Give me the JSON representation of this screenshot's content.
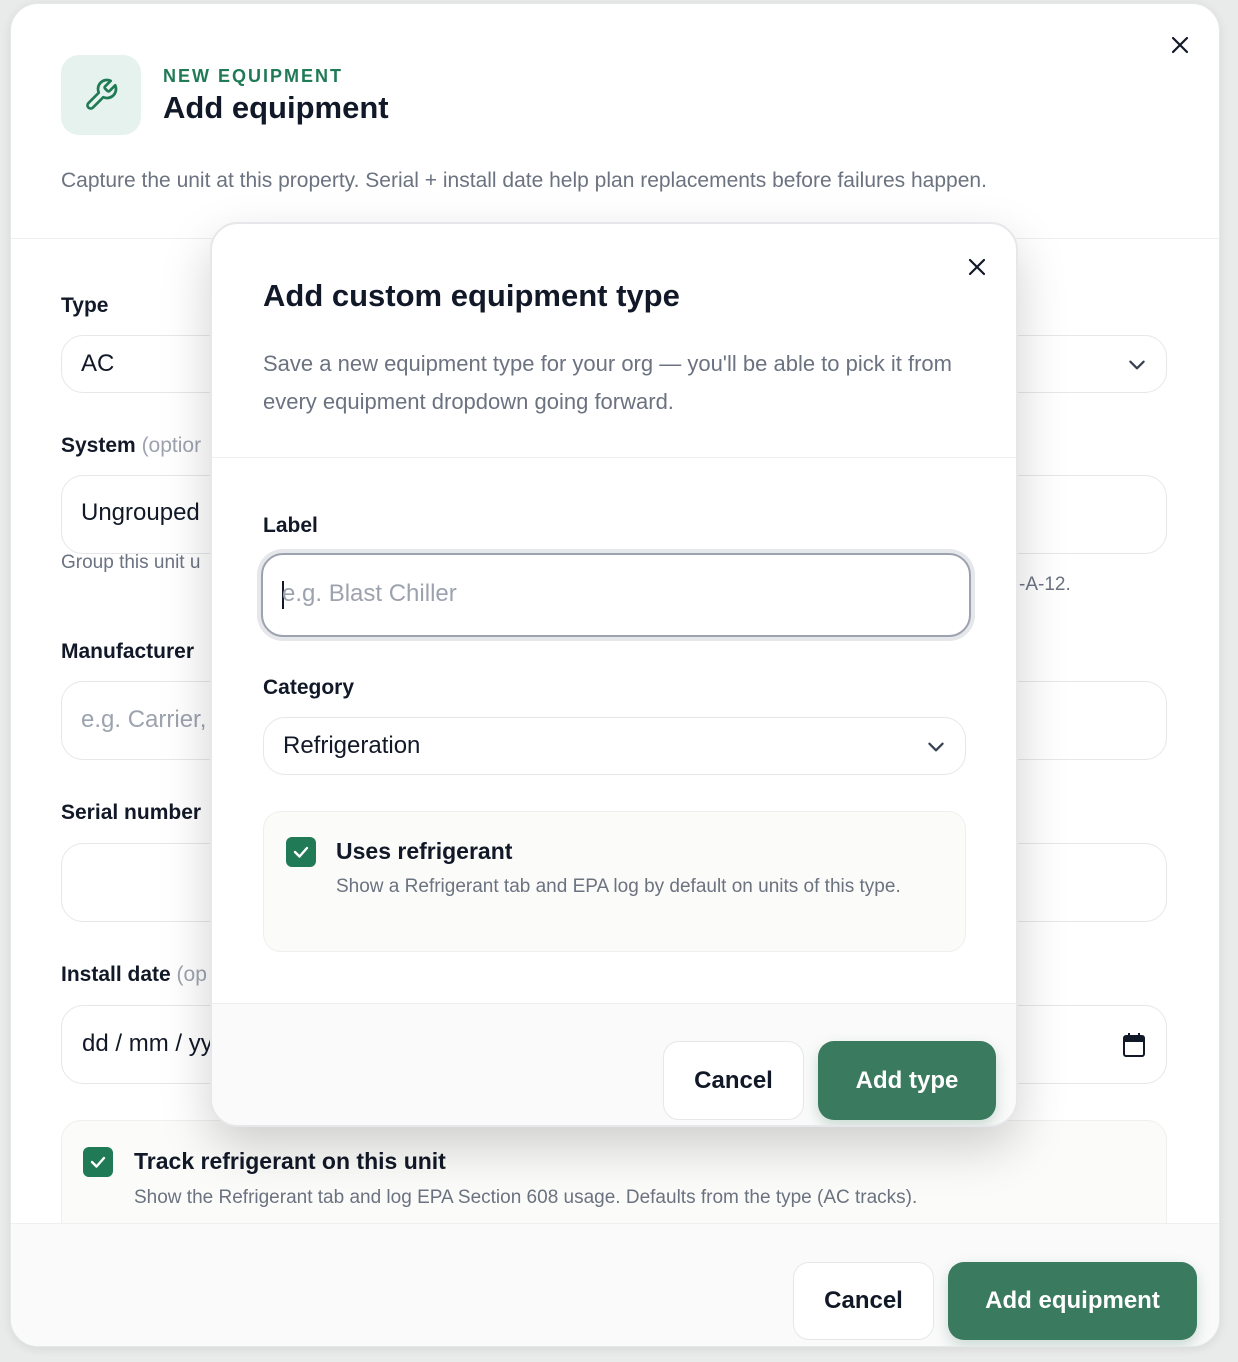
{
  "outer": {
    "eyebrow": "NEW EQUIPMENT",
    "title": "Add equipment",
    "subtitle": "Capture the unit at this property. Serial + install date help plan replacements before failures happen.",
    "icons": {
      "header": "wrench-icon",
      "close": "close-icon"
    },
    "fields": {
      "type": {
        "label": "Type",
        "value": "AC"
      },
      "system": {
        "label": "System",
        "optional": "(optior",
        "value": "Ungrouped",
        "hint": "Group this unit u",
        "hint_right": "-A-12."
      },
      "manufacturer": {
        "label": "Manufacturer",
        "placeholder": "e.g. Carrier,"
      },
      "serial": {
        "label": "Serial number",
        "value": ""
      },
      "install_date": {
        "label": "Install date",
        "optional": "(op",
        "value": "dd / mm / yy"
      }
    },
    "track": {
      "title": "Track refrigerant on this unit",
      "desc": "Show the Refrigerant tab and log EPA Section 608 usage. Defaults from the type (AC tracks).",
      "checked": true
    },
    "footer": {
      "cancel": "Cancel",
      "submit": "Add equipment"
    }
  },
  "inner": {
    "title": "Add custom equipment type",
    "desc": "Save a new equipment type for your org — you'll be able to pick it from every equipment dropdown going forward.",
    "label_field": {
      "label": "Label",
      "placeholder": "e.g. Blast Chiller"
    },
    "category_field": {
      "label": "Category",
      "value": "Refrigeration"
    },
    "uses": {
      "title": "Uses refrigerant",
      "desc": "Show a Refrigerant tab and EPA log by default on units of this type.",
      "checked": true
    },
    "footer": {
      "cancel": "Cancel",
      "submit": "Add type"
    }
  },
  "colors": {
    "accent": "#1f7a55",
    "primary_button": "#3a7a5e",
    "icon_bg": "#e6f2ee"
  }
}
